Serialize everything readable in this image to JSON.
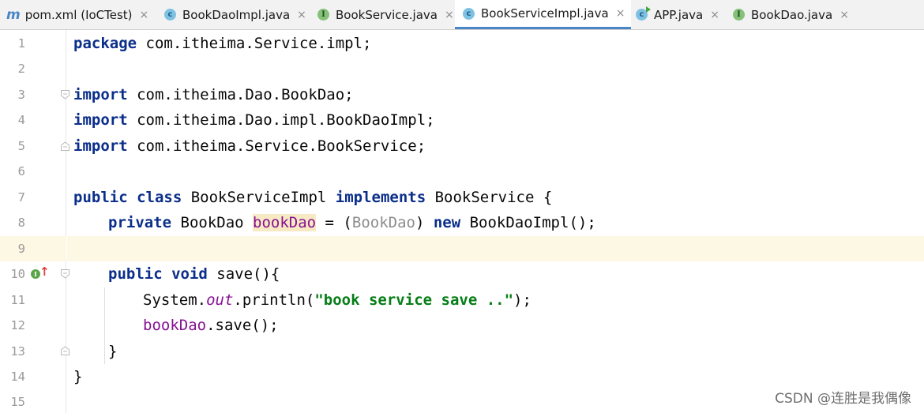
{
  "tabs": [
    {
      "icon": "maven-icon",
      "glyph": "m",
      "label": "pom.xml (IoCTest)",
      "active": false
    },
    {
      "icon": "class-icon",
      "glyph": "c",
      "label": "BookDaoImpl.java",
      "active": false
    },
    {
      "icon": "interface-icon",
      "glyph": "I",
      "label": "BookService.java",
      "active": false
    },
    {
      "icon": "class-icon",
      "glyph": "c",
      "label": "BookServiceImpl.java",
      "active": true
    },
    {
      "icon": "runnable-class-icon",
      "glyph": "c",
      "label": "APP.java",
      "active": false
    },
    {
      "icon": "interface-icon",
      "glyph": "I",
      "label": "BookDao.java",
      "active": false
    }
  ],
  "close_glyph": "×",
  "line_numbers": [
    "1",
    "2",
    "3",
    "4",
    "5",
    "6",
    "7",
    "8",
    "9",
    "10",
    "11",
    "12",
    "13",
    "14",
    "15"
  ],
  "current_line": "9",
  "gutter_markers": {
    "implements_badge": "I",
    "arrow": "↑"
  },
  "code": {
    "l1": {
      "kw": "package",
      "rest": " com.itheima.Service.impl;"
    },
    "l3": {
      "kw": "import",
      "rest": " com.itheima.Dao.BookDao;"
    },
    "l4": {
      "kw": "import",
      "rest": " com.itheima.Dao.impl.BookDaoImpl;"
    },
    "l5": {
      "kw": "import",
      "rest": " com.itheima.Service.BookService;"
    },
    "l7": {
      "kw1": "public",
      "kw2": "class",
      "name": " BookServiceImpl ",
      "kw3": "implements",
      "rest": " BookService {"
    },
    "l8": {
      "kw": "private",
      "type": " BookDao ",
      "field": "bookDao",
      "eq": " = (",
      "cast": "BookDao",
      "close": ") ",
      "kw2": "new",
      "rest": " BookDaoImpl();"
    },
    "l10": {
      "kw1": "public",
      "kw2": "void",
      "rest": " save(){"
    },
    "l11": {
      "obj": "System.",
      "field": "out",
      "call": ".println(",
      "str": "\"book service save ..\"",
      "end": ");"
    },
    "l12": {
      "field": "bookDao",
      "rest": ".save();"
    },
    "l13": {
      "text": "}"
    },
    "l14": {
      "text": "}"
    }
  },
  "watermark": "CSDN @连胜是我偶像",
  "colors": {
    "keyword": "#0a2e8a",
    "field": "#871094",
    "string": "#067d17",
    "current_line": "#fcf8e3",
    "active_tab_underline": "#4a86c7"
  }
}
